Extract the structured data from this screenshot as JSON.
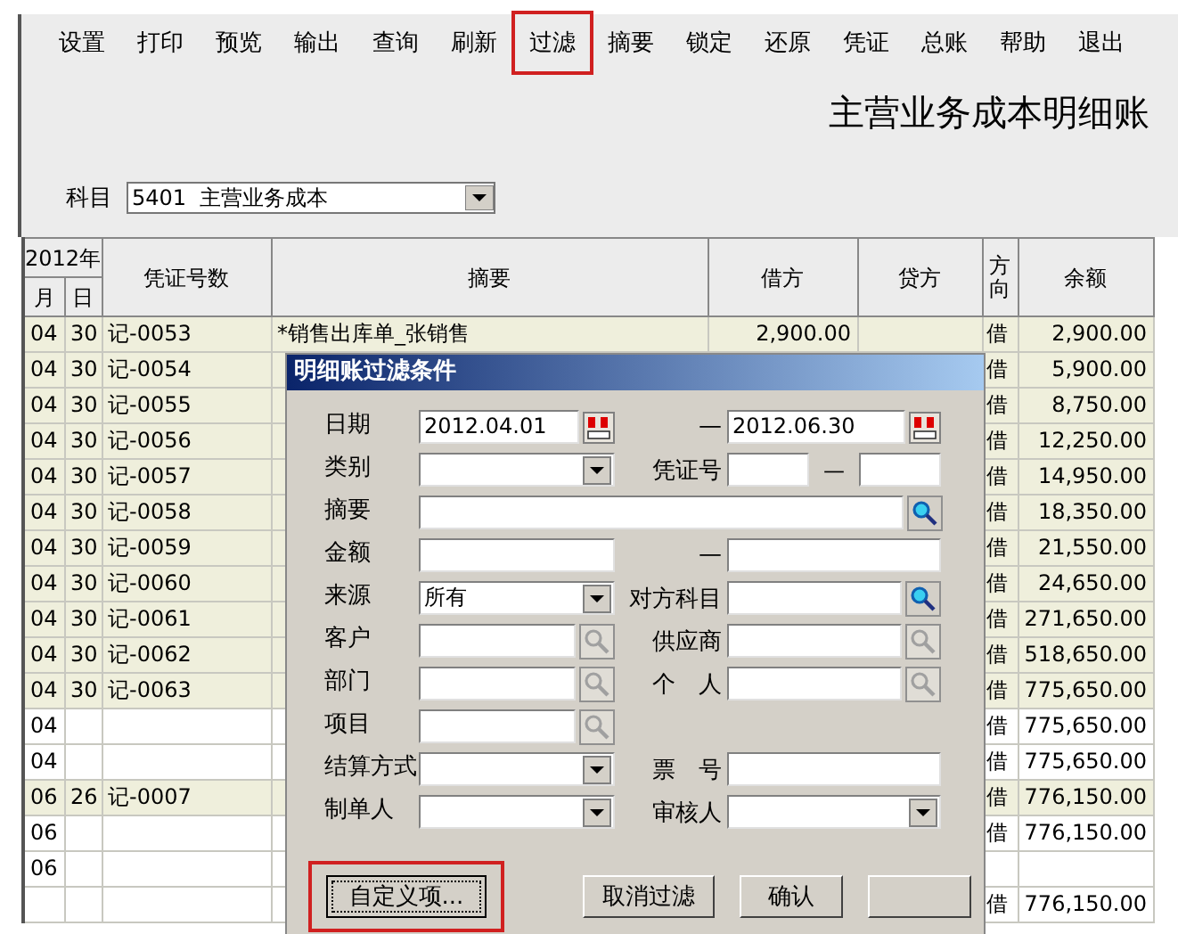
{
  "toolbar": [
    {
      "label": "设置",
      "highlighted": false
    },
    {
      "label": "打印",
      "highlighted": false
    },
    {
      "label": "预览",
      "highlighted": false
    },
    {
      "label": "输出",
      "highlighted": false
    },
    {
      "label": "查询",
      "highlighted": false
    },
    {
      "label": "刷新",
      "highlighted": false
    },
    {
      "label": "过滤",
      "highlighted": true
    },
    {
      "label": "摘要",
      "highlighted": false
    },
    {
      "label": "锁定",
      "highlighted": false
    },
    {
      "label": "还原",
      "highlighted": false
    },
    {
      "label": "凭证",
      "highlighted": false
    },
    {
      "label": "总账",
      "highlighted": false
    },
    {
      "label": "帮助",
      "highlighted": false
    },
    {
      "label": "退出",
      "highlighted": false
    }
  ],
  "report_title": "主营业务成本明细账",
  "account": {
    "label": "科目",
    "value": "5401  主营业务成本"
  },
  "table": {
    "year_header": "2012年",
    "columns": [
      "月",
      "日",
      "凭证号数",
      "摘要",
      "借方",
      "贷方",
      "方向",
      "余额"
    ],
    "rows": [
      {
        "kind": "voucher",
        "month": "04",
        "day": "30",
        "voucher": "记-0053",
        "summary": "*销售出库单_张销售",
        "debit": "2,900.00",
        "direction": "借",
        "balance": "2,900.00"
      },
      {
        "kind": "voucher",
        "month": "04",
        "day": "30",
        "voucher": "记-0054",
        "direction": "借",
        "balance": "5,900.00"
      },
      {
        "kind": "voucher",
        "month": "04",
        "day": "30",
        "voucher": "记-0055",
        "direction": "借",
        "balance": "8,750.00"
      },
      {
        "kind": "voucher",
        "month": "04",
        "day": "30",
        "voucher": "记-0056",
        "direction": "借",
        "balance": "12,250.00"
      },
      {
        "kind": "voucher",
        "month": "04",
        "day": "30",
        "voucher": "记-0057",
        "direction": "借",
        "balance": "14,950.00"
      },
      {
        "kind": "voucher",
        "month": "04",
        "day": "30",
        "voucher": "记-0058",
        "direction": "借",
        "balance": "18,350.00"
      },
      {
        "kind": "voucher",
        "month": "04",
        "day": "30",
        "voucher": "记-0059",
        "direction": "借",
        "balance": "21,550.00"
      },
      {
        "kind": "voucher",
        "month": "04",
        "day": "30",
        "voucher": "记-0060",
        "direction": "借",
        "balance": "24,650.00"
      },
      {
        "kind": "voucher",
        "month": "04",
        "day": "30",
        "voucher": "记-0061",
        "direction": "借",
        "balance": "271,650.00"
      },
      {
        "kind": "voucher",
        "month": "04",
        "day": "30",
        "voucher": "记-0062",
        "direction": "借",
        "balance": "518,650.00"
      },
      {
        "kind": "voucher",
        "month": "04",
        "day": "30",
        "voucher": "记-0063",
        "direction": "借",
        "balance": "775,650.00"
      },
      {
        "kind": "total",
        "month": "04",
        "direction": "借",
        "balance": "775,650.00"
      },
      {
        "kind": "total",
        "month": "04",
        "direction": "借",
        "balance": "775,650.00"
      },
      {
        "kind": "voucher",
        "month": "06",
        "day": "26",
        "voucher": "记-0007",
        "direction": "借",
        "balance": "776,150.00"
      },
      {
        "kind": "total",
        "month": "06",
        "direction": "借",
        "balance": "776,150.00"
      },
      {
        "kind": "total",
        "month": "06"
      },
      {
        "kind": "total",
        "direction": "借",
        "balance": "776,150.00"
      }
    ]
  },
  "dialog": {
    "title": "明细账过滤条件",
    "rows": [
      {
        "label": "日期",
        "left": {
          "kind": "date",
          "value": "2012.04.01"
        },
        "mid_label": "—",
        "right": {
          "kind": "date",
          "value": "2012.06.30"
        }
      },
      {
        "label": "类别",
        "left": {
          "kind": "select"
        },
        "mid_label": "凭证号",
        "right": {
          "kind": "range",
          "separator": "—"
        }
      },
      {
        "label": "摘要",
        "left": {
          "kind": "wide_lookup",
          "enabled": true
        }
      },
      {
        "label": "金额",
        "left": {
          "kind": "text"
        },
        "mid_label": "—",
        "right": {
          "kind": "text"
        }
      },
      {
        "label": "来源",
        "left": {
          "kind": "select",
          "value": "所有"
        },
        "mid_label": "对方科目",
        "right": {
          "kind": "lookup",
          "enabled": true
        }
      },
      {
        "label": "客户",
        "left": {
          "kind": "lookup",
          "enabled": false
        },
        "mid_label": "供应商",
        "right": {
          "kind": "lookup",
          "enabled": false
        }
      },
      {
        "label": "部门",
        "left": {
          "kind": "lookup",
          "enabled": false
        },
        "mid_label": "个　人",
        "right": {
          "kind": "lookup",
          "enabled": false
        }
      },
      {
        "label": "项目",
        "left": {
          "kind": "lookup",
          "enabled": false
        }
      },
      {
        "label": "结算方式",
        "left": {
          "kind": "select"
        },
        "mid_label": "票　号",
        "right": {
          "kind": "text"
        }
      },
      {
        "label": "制单人",
        "left": {
          "kind": "select"
        },
        "mid_label": "审核人",
        "right": {
          "kind": "select"
        }
      }
    ],
    "buttons": [
      {
        "label": "自定义项...",
        "highlighted": true
      },
      {
        "label": "取消过滤",
        "highlighted": false
      },
      {
        "label": "确认",
        "highlighted": false
      },
      {
        "highlighted": false
      }
    ]
  }
}
